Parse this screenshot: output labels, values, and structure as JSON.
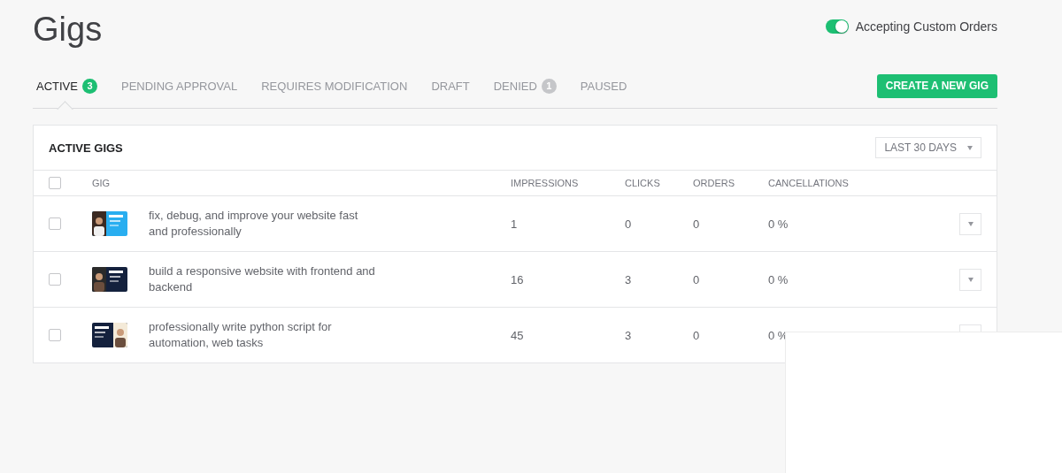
{
  "page": {
    "title": "Gigs"
  },
  "custom_orders_toggle": {
    "label": "Accepting Custom Orders",
    "on": true
  },
  "tabs": [
    {
      "label": "ACTIVE",
      "badge": "3",
      "selected": true
    },
    {
      "label": "PENDING APPROVAL",
      "selected": false
    },
    {
      "label": "REQUIRES MODIFICATION",
      "selected": false
    },
    {
      "label": "DRAFT",
      "selected": false
    },
    {
      "label": "DENIED",
      "badge": "1",
      "selected": false
    },
    {
      "label": "PAUSED",
      "selected": false
    }
  ],
  "create_button": "CREATE A NEW GIG",
  "table": {
    "title": "ACTIVE GIGS",
    "period": "LAST 30 DAYS",
    "select_all": {
      "checked": false
    },
    "columns": [
      "GIG",
      "IMPRESSIONS",
      "CLICKS",
      "ORDERS",
      "CANCELLATIONS"
    ],
    "rows": [
      {
        "checked": false,
        "title": "fix, debug, and improve your website fast and professionally",
        "impressions": "1",
        "clicks": "0",
        "orders": "0",
        "cancellations": "0 %"
      },
      {
        "checked": false,
        "title": "build a responsive website with frontend and backend",
        "impressions": "16",
        "clicks": "3",
        "orders": "0",
        "cancellations": "0 %"
      },
      {
        "checked": false,
        "title": "professionally write python script for automation, web tasks",
        "impressions": "45",
        "clicks": "3",
        "orders": "0",
        "cancellations": "0 %"
      }
    ]
  },
  "overlay_panel": {
    "kind": "blank"
  }
}
